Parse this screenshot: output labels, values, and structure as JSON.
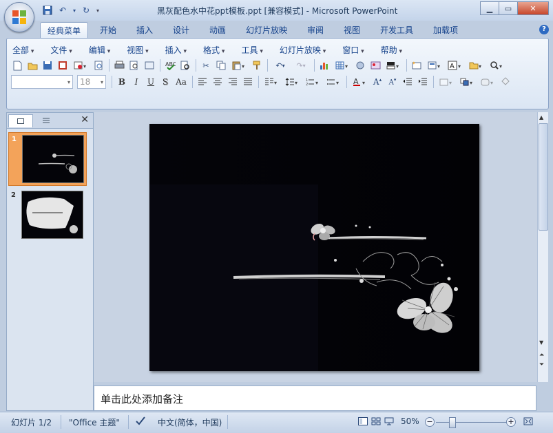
{
  "title_bar": {
    "title": "黑灰配色水中花ppt模板.ppt [兼容模式] - Microsoft PowerPoint",
    "min_icon": "minimize-icon",
    "max_icon": "maximize-icon",
    "close_icon": "close-icon"
  },
  "ribbon_tabs": [
    {
      "label": "经典菜单",
      "active": true
    },
    {
      "label": "开始"
    },
    {
      "label": "插入"
    },
    {
      "label": "设计"
    },
    {
      "label": "动画"
    },
    {
      "label": "幻灯片放映"
    },
    {
      "label": "审阅"
    },
    {
      "label": "视图"
    },
    {
      "label": "开发工具"
    },
    {
      "label": "加载项"
    }
  ],
  "menus": [
    "全部",
    "文件",
    "编辑",
    "视图",
    "插入",
    "格式",
    "工具",
    "幻灯片放映",
    "窗口",
    "帮助"
  ],
  "format_bar": {
    "font_name": "",
    "font_size": "18",
    "bold": "B",
    "italic": "I",
    "underline": "U",
    "shadow": "S",
    "change_case": "Aa"
  },
  "panel": {
    "slides": [
      {
        "number": "1",
        "selected": true
      },
      {
        "number": "2",
        "selected": false
      }
    ]
  },
  "notes": {
    "placeholder": "单击此处添加备注"
  },
  "status_bar": {
    "slide_info": "幻灯片 1/2",
    "theme": "\"Office 主题\"",
    "language": "中文(简体，中国)",
    "zoom": "50%"
  },
  "colors": {
    "accent": "#15428b",
    "slide_bg": "#040409",
    "selection": "#f3a35a"
  }
}
